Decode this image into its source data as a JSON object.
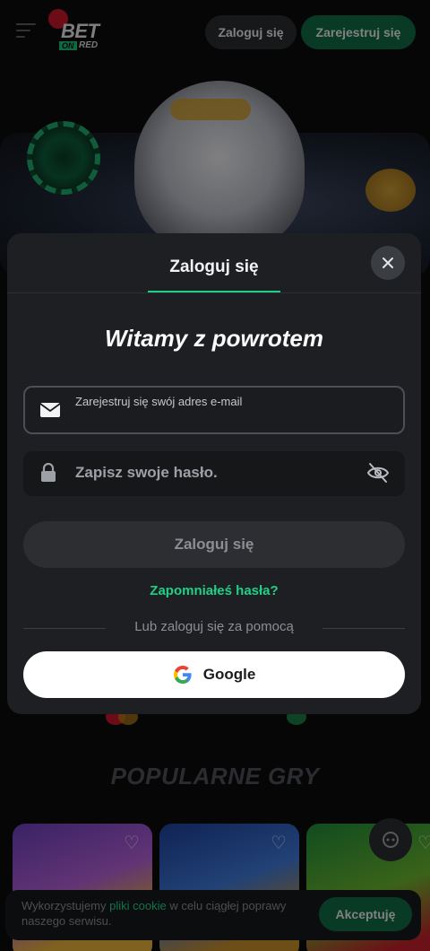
{
  "header": {
    "logo_bet": "BET",
    "logo_on": "ON",
    "logo_red": "RED",
    "login_label": "Zaloguj się",
    "register_label": "Zarejestruj się"
  },
  "body": {
    "section_title": "POPULARNE GRY"
  },
  "modal": {
    "tab_label": "Zaloguj się",
    "welcome": "Witamy z powrotem",
    "email_label": "Zarejestruj się swój adres e-mail",
    "password_placeholder": "Zapisz swoje hasło.",
    "login_button": "Zaloguj się",
    "forgot_link": "Zapomniałeś hasła?",
    "or_text": "Lub zaloguj się za pomocą",
    "google_label": "Google"
  },
  "cookie": {
    "text_before": "Wykorzystujemy ",
    "link_text": "pliki cookie",
    "text_after": " w celu ciągłej poprawy naszego serwisu.",
    "accept_label": "Akceptuję"
  },
  "colors": {
    "accent_green": "#1fd186",
    "button_green": "#0f6b45",
    "modal_bg": "#1d1f22",
    "page_bg": "#0b0c0e"
  }
}
